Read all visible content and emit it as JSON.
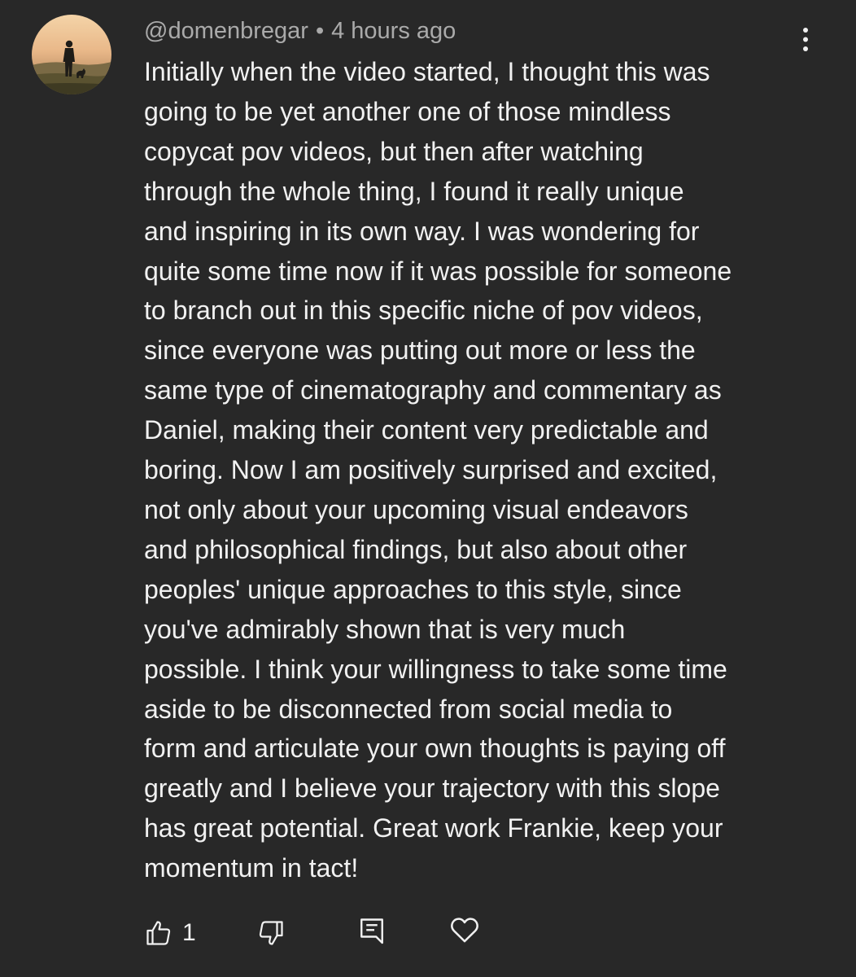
{
  "comment": {
    "author": "@domenbregar",
    "separator": "•",
    "timestamp": "4 hours ago",
    "lines": [
      "Initially when the video started, I thought this was",
      "going to be yet another one of those mindless",
      "copycat pov videos, but then after watching",
      "through the whole thing, I found it really unique",
      "and inspiring in its own way. I was wondering for",
      "quite some time now if it was possible for someone",
      "to branch out in this specific niche of pov videos,",
      "since everyone was putting out more or less the",
      "same type of cinematography and commentary as",
      "Daniel, making their content very predictable and",
      "boring. Now I am positively surprised and excited,",
      "not only about your upcoming visual endeavors",
      "and philosophical findings, but also about other",
      "peoples' unique approaches to this style, since",
      "you've admirably shown that is very much",
      "possible. I think your willingness to take some time",
      "aside to be disconnected from social media to",
      "form and articulate your own thoughts is paying off",
      "greatly and I believe your trajectory with this slope",
      "has great potential. Great work Frankie, keep your",
      "momentum in tact!"
    ],
    "like_count": "1"
  },
  "icons": {
    "menu": "more-vertical-icon",
    "like": "thumbs-up-icon",
    "dislike": "thumbs-down-icon",
    "reply": "reply-comment-icon",
    "heart": "heart-icon"
  },
  "colors": {
    "background": "#282828",
    "text_primary": "#f1f1f1",
    "text_secondary": "#aaaaaa"
  }
}
